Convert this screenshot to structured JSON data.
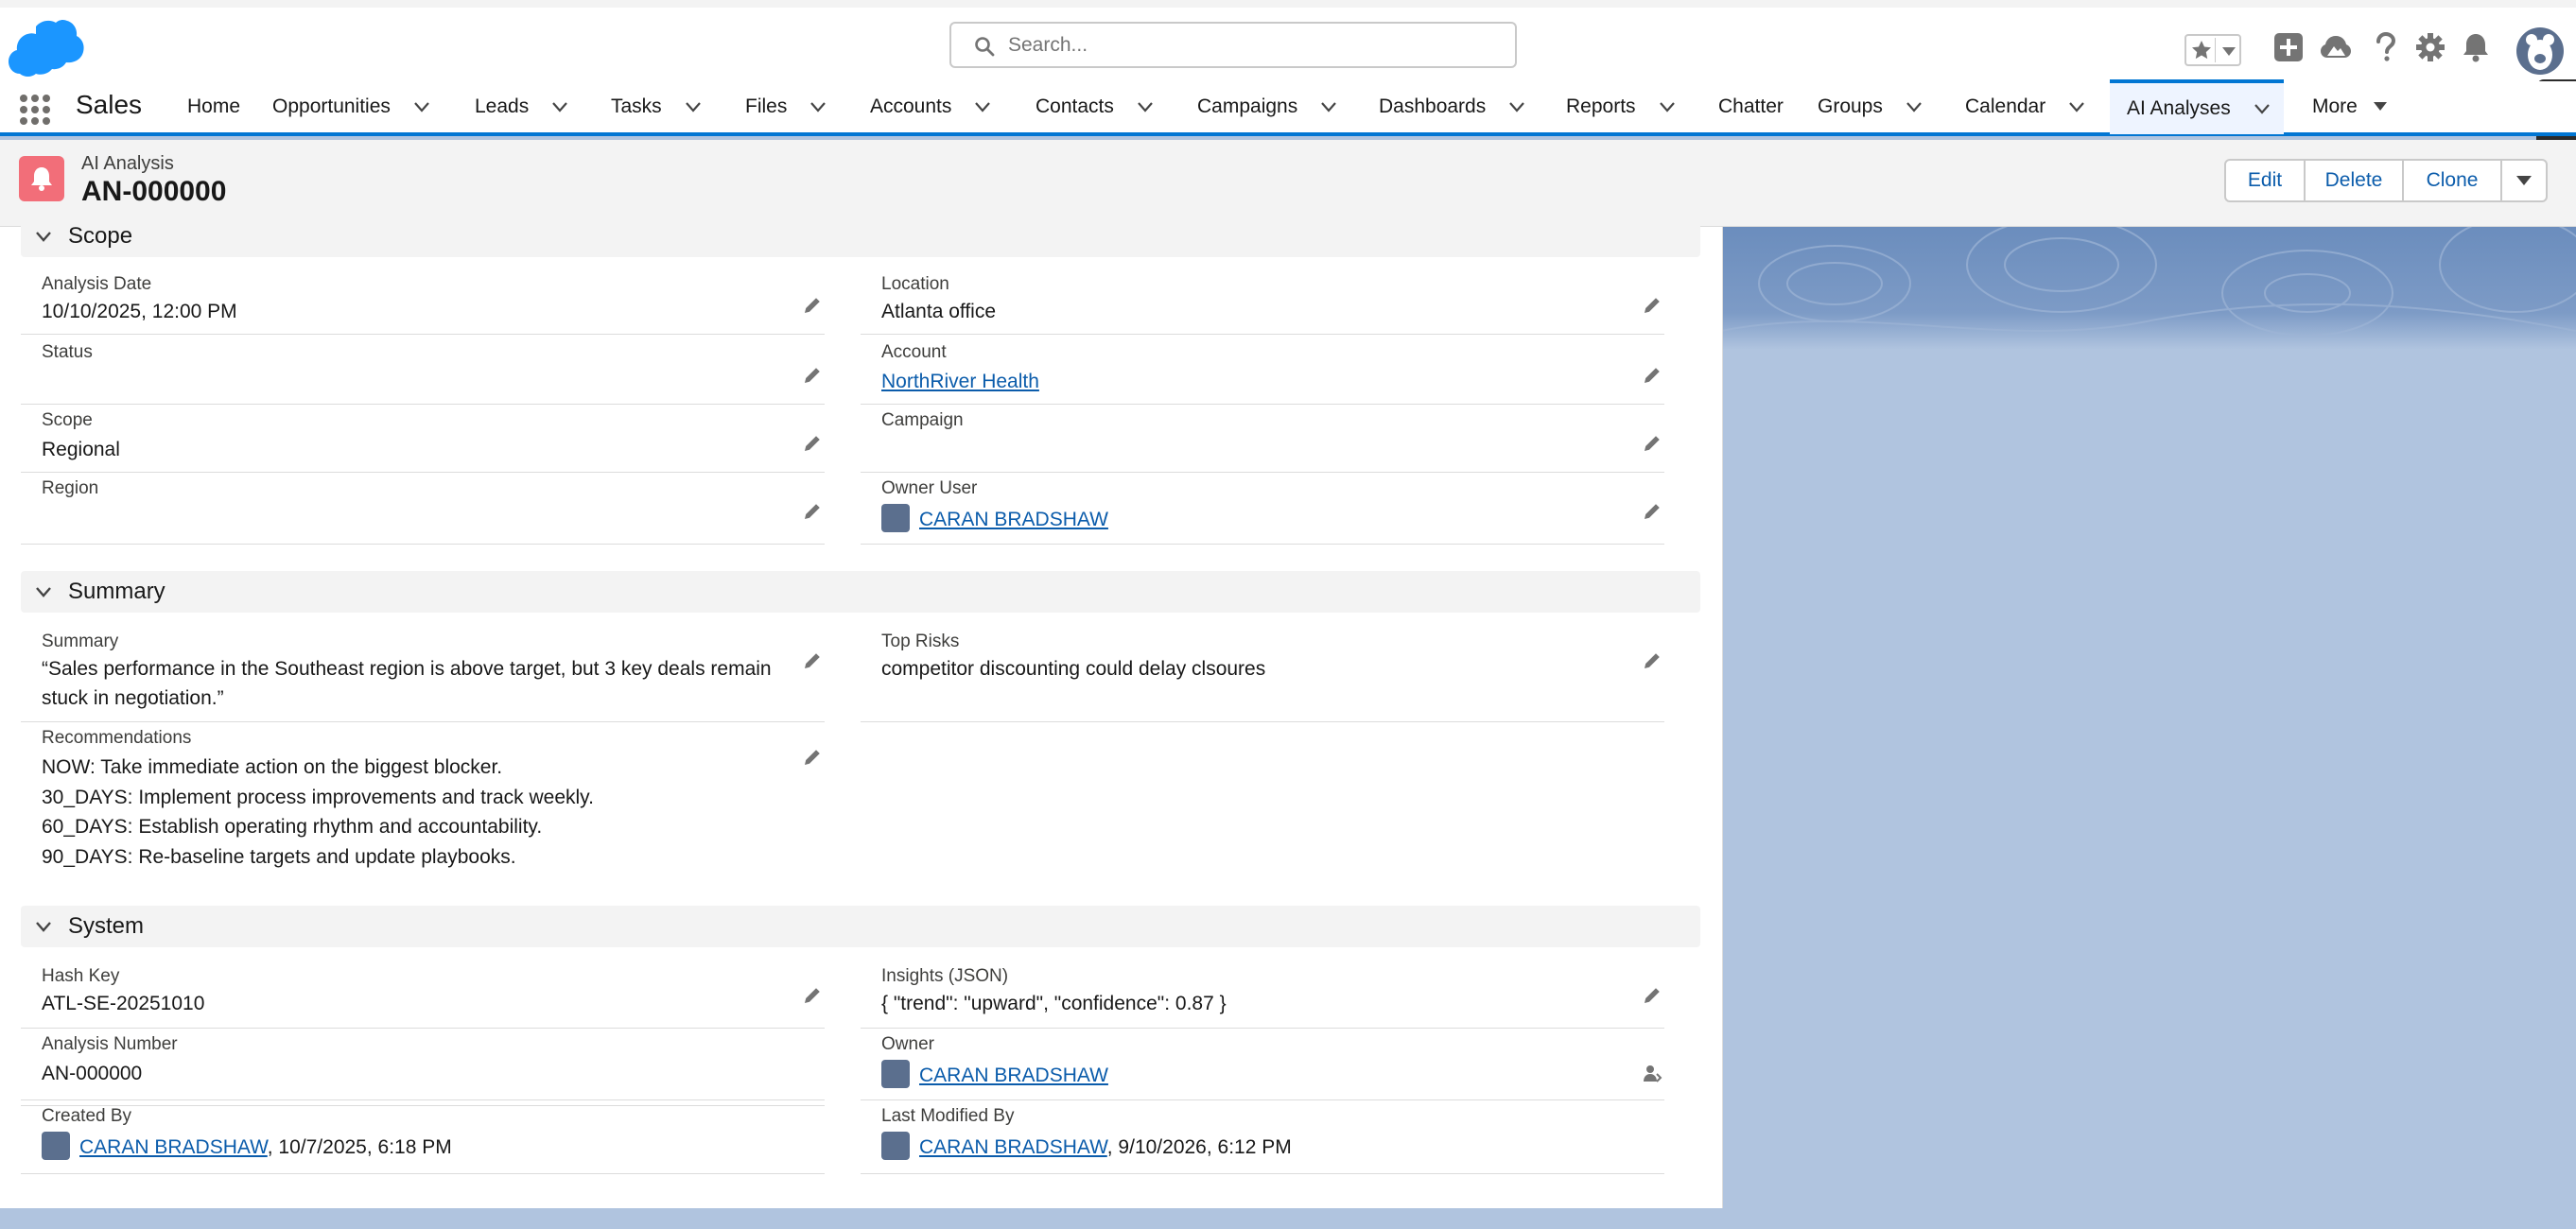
{
  "search": {
    "placeholder": "Search..."
  },
  "nav": {
    "app_name": "Sales",
    "items": [
      {
        "label": "Home"
      },
      {
        "label": "Opportunities"
      },
      {
        "label": "Leads"
      },
      {
        "label": "Tasks"
      },
      {
        "label": "Files"
      },
      {
        "label": "Accounts"
      },
      {
        "label": "Contacts"
      },
      {
        "label": "Campaigns"
      },
      {
        "label": "Dashboards"
      },
      {
        "label": "Reports"
      },
      {
        "label": "Chatter"
      },
      {
        "label": "Groups"
      },
      {
        "label": "Calendar"
      },
      {
        "label": "AI Analyses"
      },
      {
        "label": "More"
      }
    ]
  },
  "record": {
    "type": "AI Analysis",
    "name": "AN-000000",
    "actions": {
      "edit": "Edit",
      "delete": "Delete",
      "clone": "Clone"
    }
  },
  "sections": {
    "scope": {
      "title": "Scope",
      "analysis_date": {
        "label": "Analysis Date",
        "value": "10/10/2025, 12:00 PM"
      },
      "location": {
        "label": "Location",
        "value": "Atlanta office"
      },
      "status": {
        "label": "Status",
        "value": ""
      },
      "account": {
        "label": "Account",
        "value": "NorthRiver Health"
      },
      "scope": {
        "label": "Scope",
        "value": "Regional"
      },
      "campaign": {
        "label": "Campaign",
        "value": ""
      },
      "region": {
        "label": "Region",
        "value": ""
      },
      "owner_user": {
        "label": "Owner User",
        "value": "CARAN BRADSHAW"
      }
    },
    "summary": {
      "title": "Summary",
      "summary": {
        "label": "Summary",
        "value": "“Sales performance in the Southeast region is above target, but 3 key deals remain stuck in negotiation.”"
      },
      "top_risks": {
        "label": "Top Risks",
        "value": "competitor discounting could delay clsoures"
      },
      "recommendations": {
        "label": "Recommendations",
        "lines": [
          "NOW: Take immediate action on the biggest blocker.",
          "30_DAYS: Implement process improvements and track weekly.",
          "60_DAYS: Establish operating rhythm and accountability.",
          "90_DAYS: Re-baseline targets and update playbooks."
        ]
      }
    },
    "system": {
      "title": "System",
      "hash_key": {
        "label": "Hash Key",
        "value": "ATL-SE-20251010"
      },
      "insights": {
        "label": "Insights (JSON)",
        "value": "{ \"trend\": \"upward\", \"confidence\": 0.87 }"
      },
      "analysis_number": {
        "label": "Analysis Number",
        "value": "AN-000000"
      },
      "owner": {
        "label": "Owner",
        "value": "CARAN BRADSHAW"
      },
      "created_by": {
        "label": "Created By",
        "user": "CARAN BRADSHAW",
        "date": ", 10/7/2025, 6:18 PM"
      },
      "last_modified_by": {
        "label": "Last Modified By",
        "user": "CARAN BRADSHAW",
        "date": ", 9/10/2026, 6:12 PM"
      }
    }
  },
  "colors": {
    "brand": "#0176d3",
    "link": "#0b5cab",
    "record_icon": "#f26e79",
    "page_bg": "#b0c4df"
  },
  "icons": [
    "cloud-logo-icon",
    "search-icon",
    "star-icon",
    "plus-icon",
    "trailhead-icon",
    "help-icon",
    "gear-icon",
    "bell-icon",
    "app-launcher-icon",
    "bell-record-icon",
    "pencil-icon",
    "lock-icon",
    "chevron-down-icon"
  ]
}
